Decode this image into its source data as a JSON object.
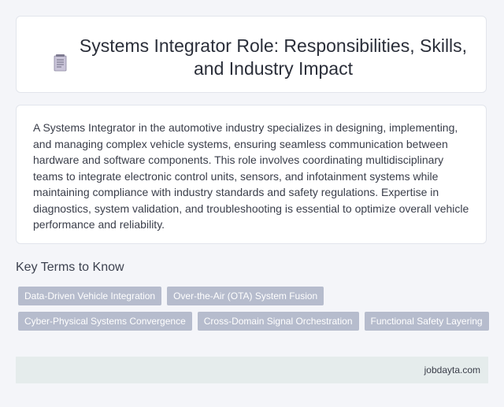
{
  "header": {
    "icon": "document-icon",
    "title": "Systems Integrator Role: Responsibilities, Skills, and Industry Impact"
  },
  "summary": {
    "text": "A Systems Integrator in the automotive industry specializes in designing, implementing, and managing complex vehicle systems, ensuring seamless communication between hardware and software components. This role involves coordinating multidisciplinary teams to integrate electronic control units, sensors, and infotainment systems while maintaining compliance with industry standards and safety regulations. Expertise in diagnostics, system validation, and troubleshooting is essential to optimize overall vehicle performance and reliability."
  },
  "key_terms": {
    "heading": "Key Terms to Know",
    "tags": [
      "Data-Driven Vehicle Integration",
      "Over-the-Air (OTA) System Fusion",
      "Cyber-Physical Systems Convergence",
      "Cross-Domain Signal Orchestration",
      "Functional Safety Layering"
    ]
  },
  "footer": {
    "site": "jobdayta.com"
  },
  "colors": {
    "background": "#f4f5f9",
    "card": "#ffffff",
    "tag": "#b6bccd",
    "footer": "#e5ecec"
  }
}
